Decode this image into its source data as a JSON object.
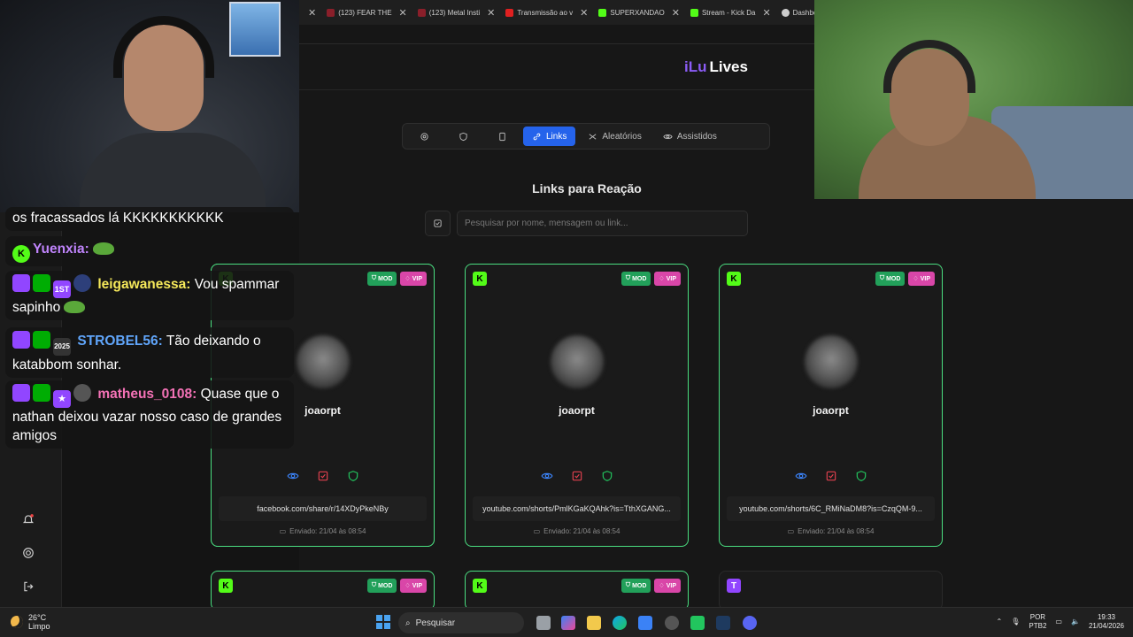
{
  "browser": {
    "tabs": [
      {
        "label": "",
        "color": "#c22"
      },
      {
        "label": "(123) FEAR THE",
        "color": "#c22"
      },
      {
        "label": "(123) Metal Insti",
        "color": "#c22"
      },
      {
        "label": "Transmissão ao v",
        "color": "#e02020"
      },
      {
        "label": "SUPERXANDAO",
        "color": "#53fc18"
      },
      {
        "label": "Stream - Kick Da",
        "color": "#53fc18"
      },
      {
        "label": "Dashboard - Li",
        "color": "#cccccc"
      }
    ]
  },
  "app": {
    "logo_a": "iLu",
    "logo_b": "Lives",
    "nav": {
      "links": "Links",
      "random": "Aleatórios",
      "watched": "Assistidos"
    },
    "section_title": "Links para Reação",
    "search_placeholder": "Pesquisar por nome, mensagem ou link...",
    "badge_mod": "MOD",
    "badge_vip": "VIP",
    "cards": [
      {
        "platform": "K",
        "username": "joaorpt",
        "link": "facebook.com/share/r/14XDyPkeNBy",
        "sent": "Enviado: 21/04 às 08:54"
      },
      {
        "platform": "K",
        "username": "joaorpt",
        "link": "youtube.com/shorts/PmlKGaKQAhk?is=TthXGANG...",
        "sent": "Enviado: 21/04 às 08:54"
      },
      {
        "platform": "K",
        "username": "joaorpt",
        "link": "youtube.com/shorts/6C_RMiNaDM8?is=CzqQM-9...",
        "sent": "Enviado: 21/04 às 08:54"
      }
    ],
    "row2": [
      {
        "platform": "K"
      },
      {
        "platform": "K"
      },
      {
        "platform": "T"
      }
    ]
  },
  "chat": [
    {
      "name": "",
      "text": "os fracassados lá KKKKKKKKKKK"
    },
    {
      "name": "Yuenxia:",
      "text": "",
      "name_color": "#c084fc"
    },
    {
      "name": "leigawanessa:",
      "text": "Vou spammar sapinho",
      "name_color": "#f5e85a",
      "b1": "1ST"
    },
    {
      "name": "STROBEL56:",
      "text": "Tão deixando o katabbom sonhar.",
      "name_color": "#60a5fa",
      "b1": "2025"
    },
    {
      "name": "matheus_0108:",
      "text": "Quase que o nathan deixou vazar nosso caso de grandes amigos",
      "name_color": "#f472b6"
    }
  ],
  "taskbar": {
    "temp": "26°C",
    "weather": "Limpo",
    "search": "Pesquisar",
    "lang1": "POR",
    "lang2": "PTB2",
    "time": "19:33",
    "date": "21/04/2026"
  }
}
